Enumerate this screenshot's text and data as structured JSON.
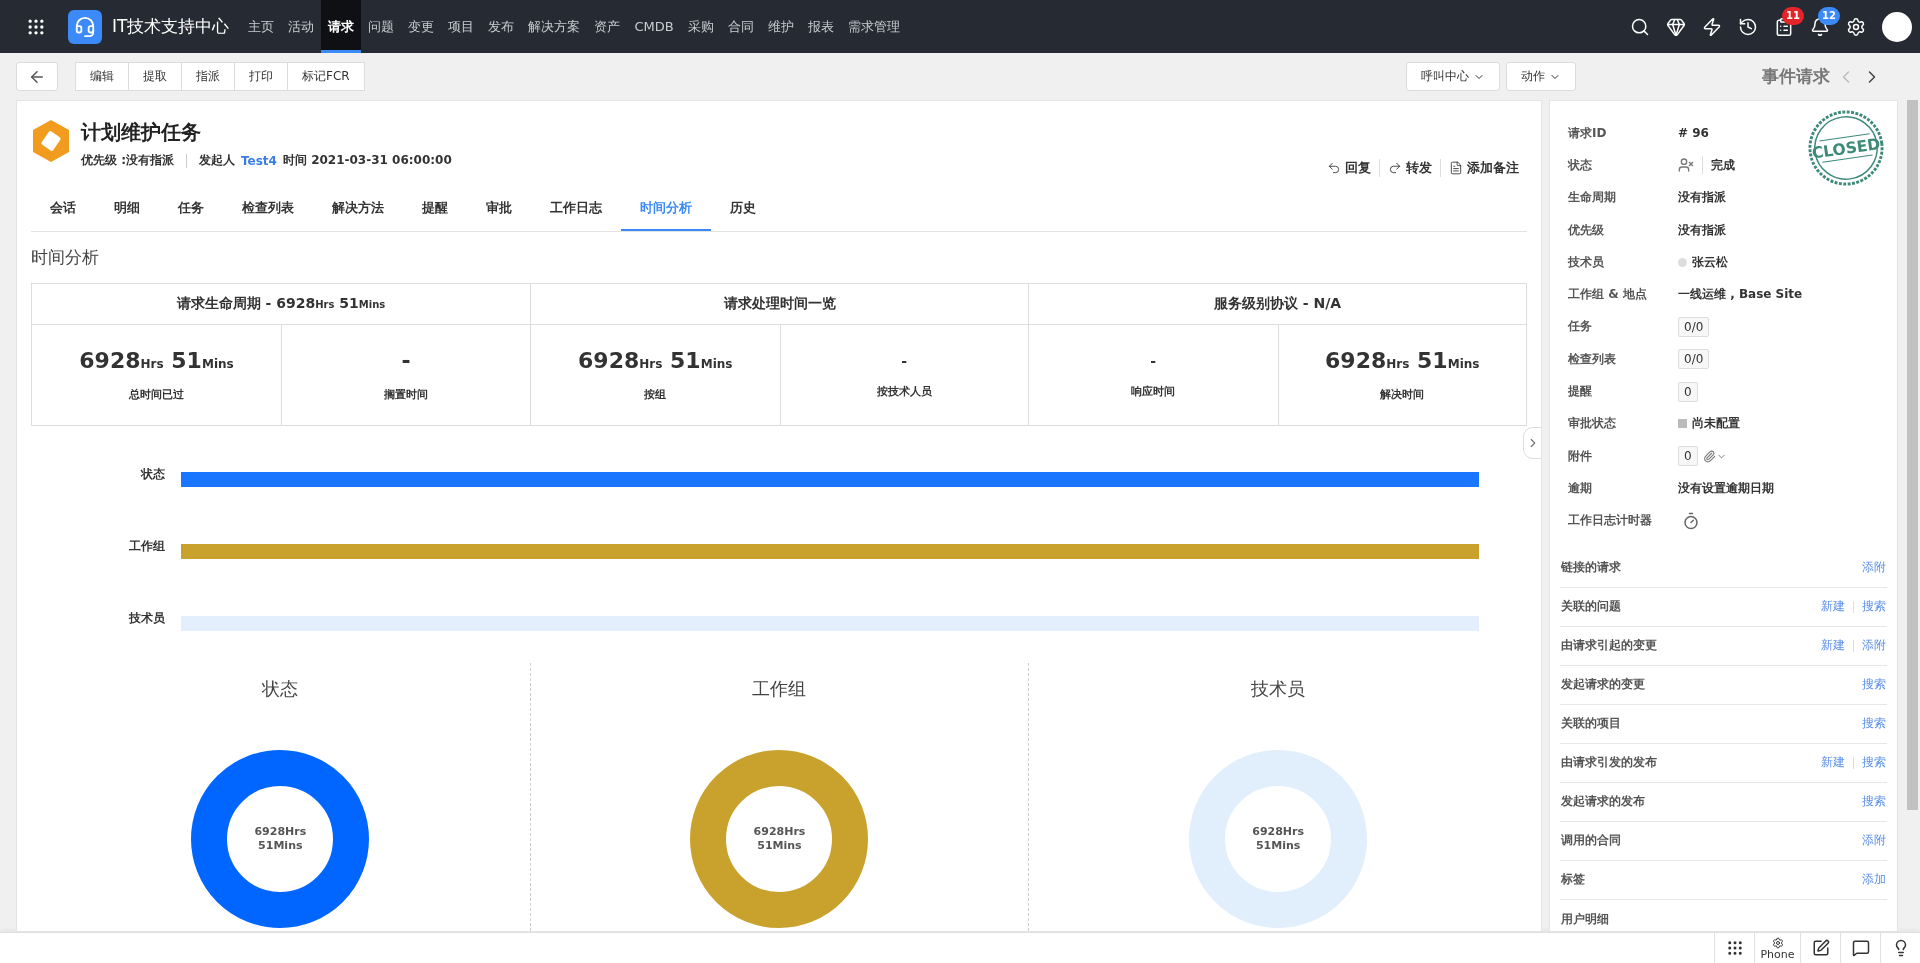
{
  "nav": {
    "app_title": "IT技术支持中心",
    "items": [
      {
        "label": "主页",
        "selected": false
      },
      {
        "label": "活动",
        "selected": false
      },
      {
        "label": "请求",
        "selected": true
      },
      {
        "label": "问题",
        "selected": false
      },
      {
        "label": "变更",
        "selected": false
      },
      {
        "label": "项目",
        "selected": false
      },
      {
        "label": "发布",
        "selected": false
      },
      {
        "label": "解决方案",
        "selected": false
      },
      {
        "label": "资产",
        "selected": false
      },
      {
        "label": "CMDB",
        "selected": false
      },
      {
        "label": "采购",
        "selected": false
      },
      {
        "label": "合同",
        "selected": false
      },
      {
        "label": "维护",
        "selected": false
      },
      {
        "label": "报表",
        "selected": false
      },
      {
        "label": "需求管理",
        "selected": false
      }
    ],
    "task_badge": "11",
    "notification_badge": "12"
  },
  "toolbar": {
    "buttons": [
      "编辑",
      "提取",
      "指派",
      "打印",
      "标记FCR"
    ],
    "dropdowns": [
      "呼叫中心",
      "动作"
    ],
    "record_type": "事件请求"
  },
  "request": {
    "title": "计划维护任务",
    "priority": "优先级 :没有指派",
    "requester_label": "发起人",
    "requester": "Test4",
    "time": "时间 2021-03-31 06:00:00",
    "actions": [
      "回复",
      "转发",
      "添加备注"
    ]
  },
  "tabs": [
    {
      "label": "会话",
      "selected": false
    },
    {
      "label": "明细",
      "selected": false
    },
    {
      "label": "任务",
      "selected": false
    },
    {
      "label": "检查列表",
      "selected": false
    },
    {
      "label": "解决方法",
      "selected": false
    },
    {
      "label": "提醒",
      "selected": false
    },
    {
      "label": "审批",
      "selected": false
    },
    {
      "label": "工作日志",
      "selected": false
    },
    {
      "label": "时间分析",
      "selected": true
    },
    {
      "label": "历史",
      "selected": false
    }
  ],
  "section_title": "时间分析",
  "summary": {
    "groups": [
      {
        "title": [
          {
            "kind": "text",
            "text": "请求生命周期 - "
          },
          {
            "kind": "number",
            "text": "6928"
          },
          {
            "kind": "unit",
            "text": "Hrs"
          },
          {
            "kind": "number",
            "text": " 51"
          },
          {
            "kind": "unit",
            "text": "Mins"
          }
        ],
        "cells": [
          {
            "value": [
              {
                "kind": "number",
                "text": "6928"
              },
              {
                "kind": "unit",
                "text": "Hrs"
              },
              {
                "kind": "number",
                "text": " 51"
              },
              {
                "kind": "unit",
                "text": "Mins"
              }
            ],
            "label": "总时间已过"
          },
          {
            "value": [
              {
                "kind": "number",
                "text": "-"
              }
            ],
            "label": "搁置时间"
          }
        ]
      },
      {
        "title": [
          {
            "kind": "text",
            "text": "请求处理时间一览"
          }
        ],
        "cells": [
          {
            "value": [
              {
                "kind": "number",
                "text": "6928"
              },
              {
                "kind": "unit",
                "text": "Hrs"
              },
              {
                "kind": "number",
                "text": " 51"
              },
              {
                "kind": "unit",
                "text": "Mins"
              }
            ],
            "label": "按组"
          },
          {
            "value": [
              {
                "kind": "text",
                "text": "-"
              }
            ],
            "label": "按技术人员"
          }
        ]
      },
      {
        "title": [
          {
            "kind": "text",
            "text": "服务级别协议 - N/A"
          }
        ],
        "cells": [
          {
            "value": [
              {
                "kind": "text",
                "text": "-"
              }
            ],
            "label": "响应时间"
          },
          {
            "value": [
              {
                "kind": "number",
                "text": "6928"
              },
              {
                "kind": "unit",
                "text": "Hrs"
              },
              {
                "kind": "number",
                "text": " 51"
              },
              {
                "kind": "unit",
                "text": "Mins"
              }
            ],
            "label": "解决时间"
          }
        ]
      }
    ]
  },
  "timeline": [
    {
      "label": "状态",
      "color": "#1a75ff"
    },
    {
      "label": "工作组",
      "color": "#c9a22e"
    },
    {
      "label": "技术员",
      "color": "#e3effc"
    }
  ],
  "donuts": [
    {
      "title": "状态",
      "center": [
        "6928Hrs",
        "51Mins"
      ],
      "color": "#0066ff"
    },
    {
      "title": "工作组",
      "center": [
        "6928Hrs",
        "51Mins"
      ],
      "color": "#c9a22e"
    },
    {
      "title": "技术员",
      "center": [
        "6928Hrs",
        "51Mins"
      ],
      "color": "#e1eefc"
    }
  ],
  "details": {
    "stamp": "CLOSED",
    "fields": [
      {
        "kind": "text",
        "label": "请求ID",
        "value": "# 96"
      },
      {
        "kind": "status",
        "label": "状态",
        "value": "完成"
      },
      {
        "kind": "text",
        "label": "生命周期",
        "value": "没有指派"
      },
      {
        "kind": "text",
        "label": "优先级",
        "value": "没有指派"
      },
      {
        "kind": "person",
        "label": "技术员",
        "value": "张云松"
      },
      {
        "kind": "text",
        "label": "工作组 & 地点",
        "value": "一线运维 , Base Site"
      },
      {
        "kind": "count",
        "label": "任务",
        "value": "0/0"
      },
      {
        "kind": "count",
        "label": "检查列表",
        "value": "0/0"
      },
      {
        "kind": "count",
        "label": "提醒",
        "value": "0"
      },
      {
        "kind": "approval",
        "label": "审批状态",
        "value": "尚未配置"
      },
      {
        "kind": "attachment",
        "label": "附件",
        "value": "0"
      },
      {
        "kind": "text",
        "label": "逾期",
        "value": "没有设置逾期日期"
      },
      {
        "kind": "timer",
        "label": "工作日志计时器"
      }
    ],
    "links": [
      {
        "label": "链接的请求",
        "actions": [
          "添附"
        ]
      },
      {
        "label": "关联的问题",
        "actions": [
          "新建",
          "搜索"
        ]
      },
      {
        "label": "由请求引起的变更",
        "actions": [
          "新建",
          "添附"
        ]
      },
      {
        "label": "发起请求的变更",
        "actions": [
          "搜索"
        ]
      },
      {
        "label": "关联的项目",
        "actions": [
          "搜索"
        ]
      },
      {
        "label": "由请求引发的发布",
        "actions": [
          "新建",
          "搜索"
        ]
      },
      {
        "label": "发起请求的发布",
        "actions": [
          "搜索"
        ]
      },
      {
        "label": "调用的合同",
        "actions": [
          "添附"
        ]
      },
      {
        "label": "标签",
        "actions": [
          "添加"
        ]
      },
      {
        "label": "用户明细"
      }
    ]
  },
  "footer": {
    "phone_label": "Phone"
  }
}
